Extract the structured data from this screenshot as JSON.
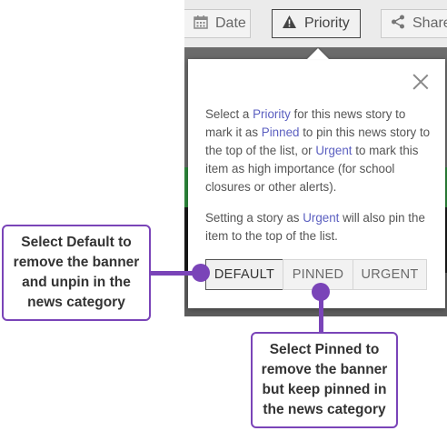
{
  "toolbar": {
    "date_label": "Date",
    "priority_label": "Priority",
    "share_label": "Share",
    "date_icon": "calendar-icon",
    "priority_icon": "warning-icon",
    "share_icon": "share-icon"
  },
  "popover": {
    "p1": {
      "a": "Select a ",
      "b": "Priority",
      "c": " for this news story to mark it as ",
      "d": "Pinned",
      "e": " to pin this news story to the top of the list, or ",
      "f": "Urgent",
      "g": " to mark this item as high importance (for school closures or other alerts)."
    },
    "p2": {
      "a": "Setting a story as ",
      "b": "Urgent",
      "c": " will also pin the item to the top of the list."
    },
    "buttons": {
      "default": "DEFAULT",
      "pinned": "PINNED",
      "urgent": "URGENT"
    },
    "selected": "DEFAULT"
  },
  "callouts": {
    "default": "Select Default to remove the banner and unpin in the news category",
    "pinned": "Select Pinned to remove the banner but keep pinned in the news category"
  },
  "colors": {
    "accent": "#7a44b8",
    "link": "#5b5fc0",
    "banner_green": "#2e8a3c"
  }
}
